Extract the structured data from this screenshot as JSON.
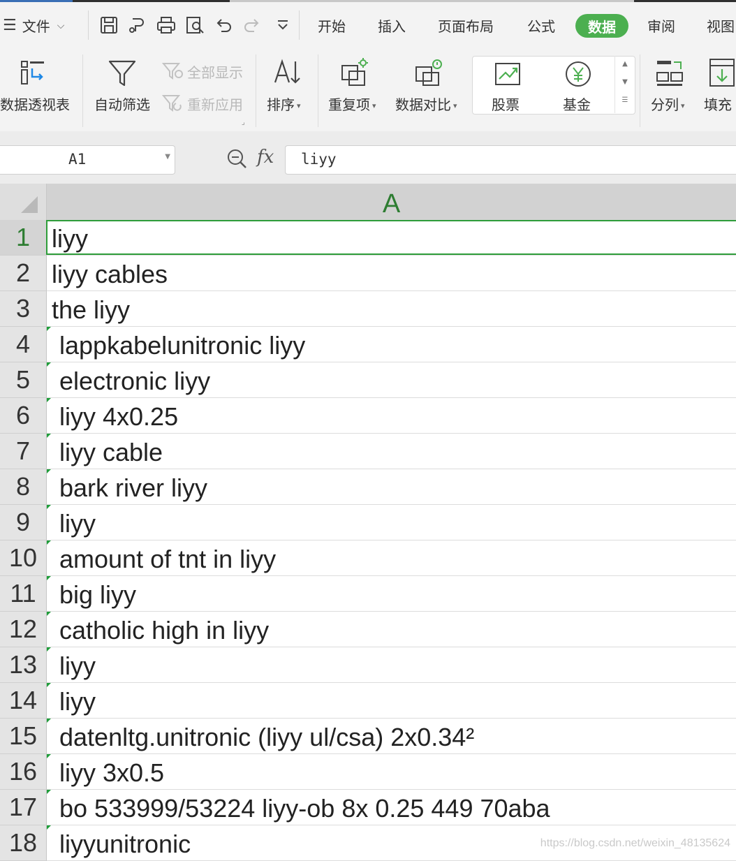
{
  "menu": {
    "file_label": "文件",
    "tabs": [
      "开始",
      "插入",
      "页面布局",
      "公式",
      "数据",
      "审阅",
      "视图"
    ],
    "active_tab": "数据"
  },
  "ribbon": {
    "pivot_label": "数据透视表",
    "autofilter_label": "自动筛选",
    "show_all_label": "全部显示",
    "reapply_label": "重新应用",
    "sort_label": "排序",
    "duplicates_label": "重复项",
    "compare_label": "数据对比",
    "stock_label": "股票",
    "fund_label": "基金",
    "split_label": "分列",
    "fill_label": "填充"
  },
  "formula_bar": {
    "cell_ref": "A1",
    "content": "liyy"
  },
  "sheet": {
    "column_header": "A",
    "rows": [
      {
        "n": "1",
        "text": "liyy"
      },
      {
        "n": "2",
        "text": "liyy cables"
      },
      {
        "n": "3",
        "text": "the liyy"
      },
      {
        "n": "4",
        "text": "lappkabelunitronic liyy"
      },
      {
        "n": "5",
        "text": "electronic liyy"
      },
      {
        "n": "6",
        "text": "liyy 4x0.25"
      },
      {
        "n": "7",
        "text": "liyy cable"
      },
      {
        "n": "8",
        "text": "bark river liyy"
      },
      {
        "n": "9",
        "text": "liyy"
      },
      {
        "n": "10",
        "text": "amount of tnt in liyy"
      },
      {
        "n": "11",
        "text": "big liyy"
      },
      {
        "n": "12",
        "text": "catholic high in liyy"
      },
      {
        "n": "13",
        "text": "liyy"
      },
      {
        "n": "14",
        "text": "liyy"
      },
      {
        "n": "15",
        "text": "datenltg.unitronic (liyy ul/csa) 2x0.34²"
      },
      {
        "n": "16",
        "text": "liyy 3x0.5"
      },
      {
        "n": "17",
        "text": "bo 533999/53224 liyy-ob 8x 0.25 449 70aba"
      },
      {
        "n": "18",
        "text": "liyyunitronic"
      }
    ]
  },
  "watermark": "https://blog.csdn.net/weixin_48135624",
  "colors": {
    "accent": "#4caf50",
    "selection": "#2e9d3a",
    "header_green": "#2e7d32"
  }
}
